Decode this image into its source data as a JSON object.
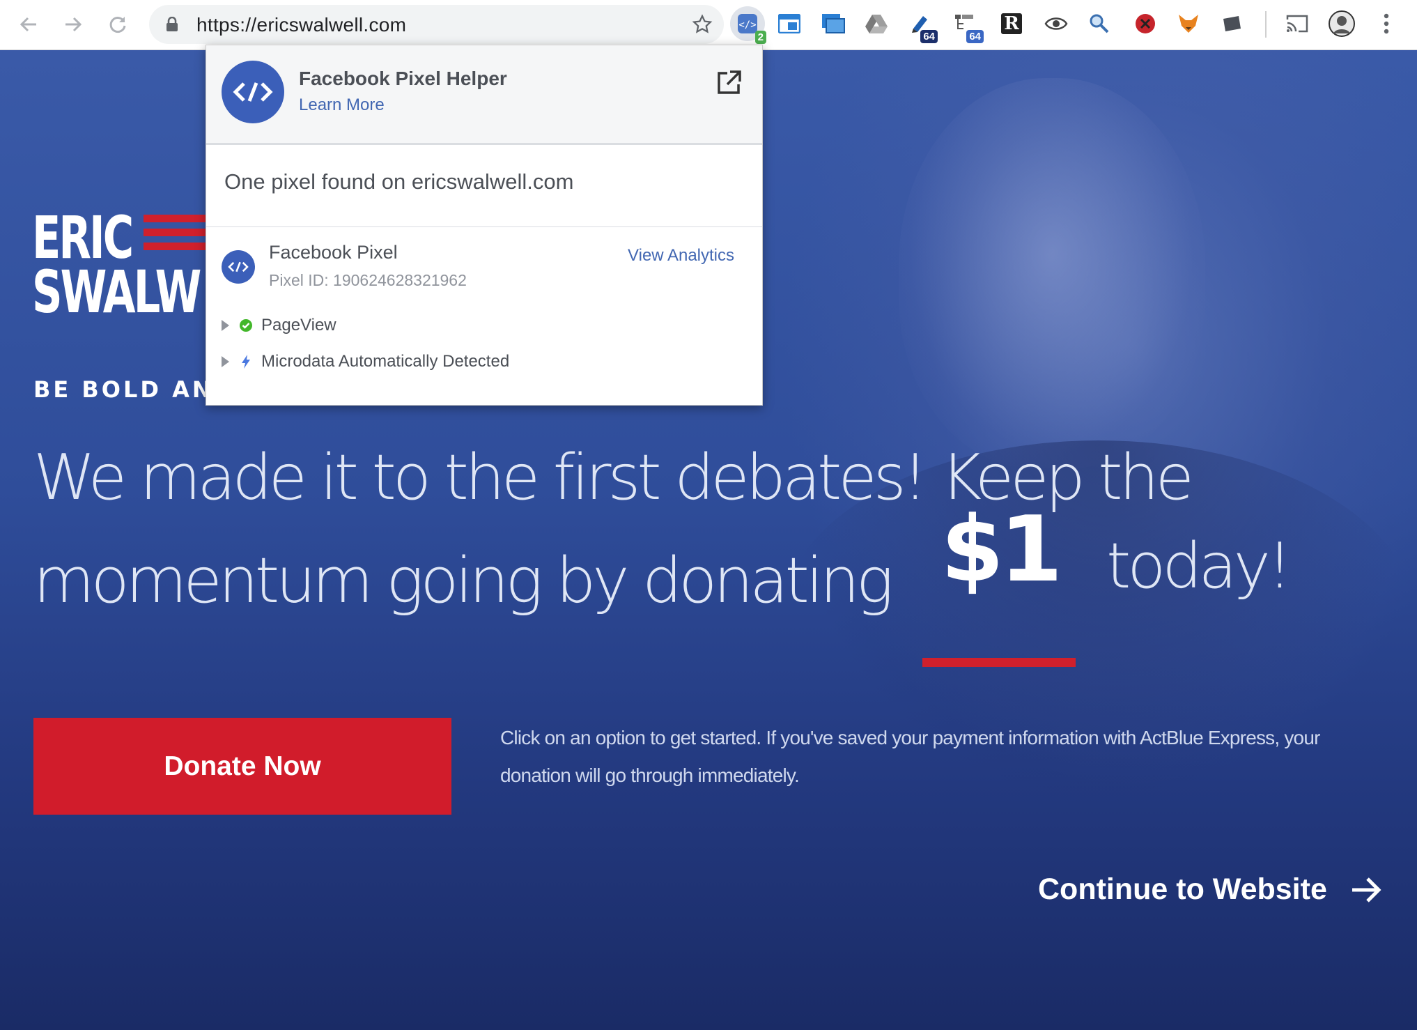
{
  "browser": {
    "url": "https://ericswalwell.com",
    "extensions": [
      {
        "icon": "facebook-pixel-helper-icon",
        "badge": "2"
      },
      {
        "icon": "window-tabs-icon"
      },
      {
        "icon": "screen-capture-icon"
      },
      {
        "icon": "google-drive-icon"
      },
      {
        "icon": "ink-pen-icon",
        "badge": "64"
      },
      {
        "icon": "network-tree-icon",
        "badge": "64"
      },
      {
        "icon": "r-letter-icon",
        "label": "R"
      },
      {
        "icon": "eye-icon"
      },
      {
        "icon": "magnifier-user-icon"
      },
      {
        "icon": "blocked-red-icon"
      },
      {
        "icon": "fox-icon"
      },
      {
        "icon": "tablet-icon"
      }
    ]
  },
  "popup": {
    "title": "Facebook Pixel Helper",
    "learn_more": "Learn More",
    "found_text": "One pixel found on ericswalwell.com",
    "pixel_name": "Facebook Pixel",
    "pixel_id": "Pixel ID: 190624628321962",
    "view_analytics": "View Analytics",
    "events": [
      {
        "label": "PageView",
        "status": "success"
      },
      {
        "label": "Microdata Automatically Detected",
        "status": "lightning"
      }
    ]
  },
  "page": {
    "logo_line1": "ERIC",
    "logo_line2": "SWALW",
    "tagline": "BE BOLD AND",
    "headline_line1": "We made it to the first debates! Keep the",
    "headline_line2": "momentum going by donating",
    "amount": "$1",
    "headline_end": "today!",
    "donate_label": "Donate Now",
    "helper_text": "Click on an option to get started. If you've saved your payment information with ActBlue Express, your donation will go through immediately.",
    "continue_label": "Continue to Website"
  },
  "colors": {
    "brand_red": "#d11c2b",
    "page_blue": "#2f4d9a",
    "fb_blue": "#4267b2"
  }
}
